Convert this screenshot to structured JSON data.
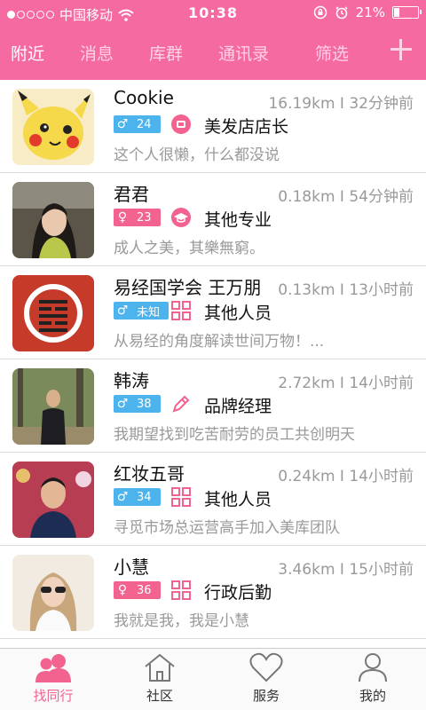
{
  "status_bar": {
    "carrier": "中国移动",
    "time": "10:38",
    "battery": "21%",
    "battery_level": 0.21
  },
  "nav": {
    "tabs": [
      {
        "label": "附近",
        "active": true
      },
      {
        "label": "消息"
      },
      {
        "label": "库群"
      },
      {
        "label": "通讯录"
      },
      {
        "label": "筛选"
      }
    ]
  },
  "users": [
    {
      "name": "Cookie",
      "distance": "16.19km",
      "time": "32分钟前",
      "gender": "male",
      "age": "24",
      "job_icon": "barber-icon",
      "job": "美发店店长",
      "signature": "这个人很懒，什么都没说"
    },
    {
      "name": "君君",
      "distance": "0.18km",
      "time": "54分钟前",
      "gender": "female",
      "age": "23",
      "job_icon": "graduation-cap-icon",
      "job": "其他专业",
      "signature": "成人之美，其樂無窮。"
    },
    {
      "name": "易经国学会 王万朋",
      "distance": "0.13km",
      "time": "13小时前",
      "gender": "male",
      "age": "未知",
      "job_icon": "grid-icon",
      "job": "其他人员",
      "signature": "从易经的角度解读世间万物！..."
    },
    {
      "name": "韩涛",
      "distance": "2.72km",
      "time": "14小时前",
      "gender": "male",
      "age": "38",
      "job_icon": "pencil-icon",
      "job": "品牌经理",
      "signature": "我期望找到吃苦耐劳的员工共创明天"
    },
    {
      "name": "红妆五哥",
      "distance": "0.24km",
      "time": "14小时前",
      "gender": "male",
      "age": "34",
      "job_icon": "grid-icon",
      "job": "其他人员",
      "signature": "寻觅市场总运营高手加入美库团队"
    },
    {
      "name": "小慧",
      "distance": "3.46km",
      "time": "15小时前",
      "gender": "female",
      "age": "36",
      "job_icon": "grid-icon",
      "job": "行政后勤",
      "signature": "我就是我，我是小慧"
    }
  ],
  "tabbar": [
    {
      "label": "找同行",
      "icon": "people-icon",
      "active": true
    },
    {
      "label": "社区",
      "icon": "house-icon"
    },
    {
      "label": "服务",
      "icon": "heart-icon"
    },
    {
      "label": "我的",
      "icon": "person-icon"
    }
  ],
  "colors": {
    "brand": "#f56aa1",
    "male": "#4db3ec",
    "female": "#f2638f"
  }
}
